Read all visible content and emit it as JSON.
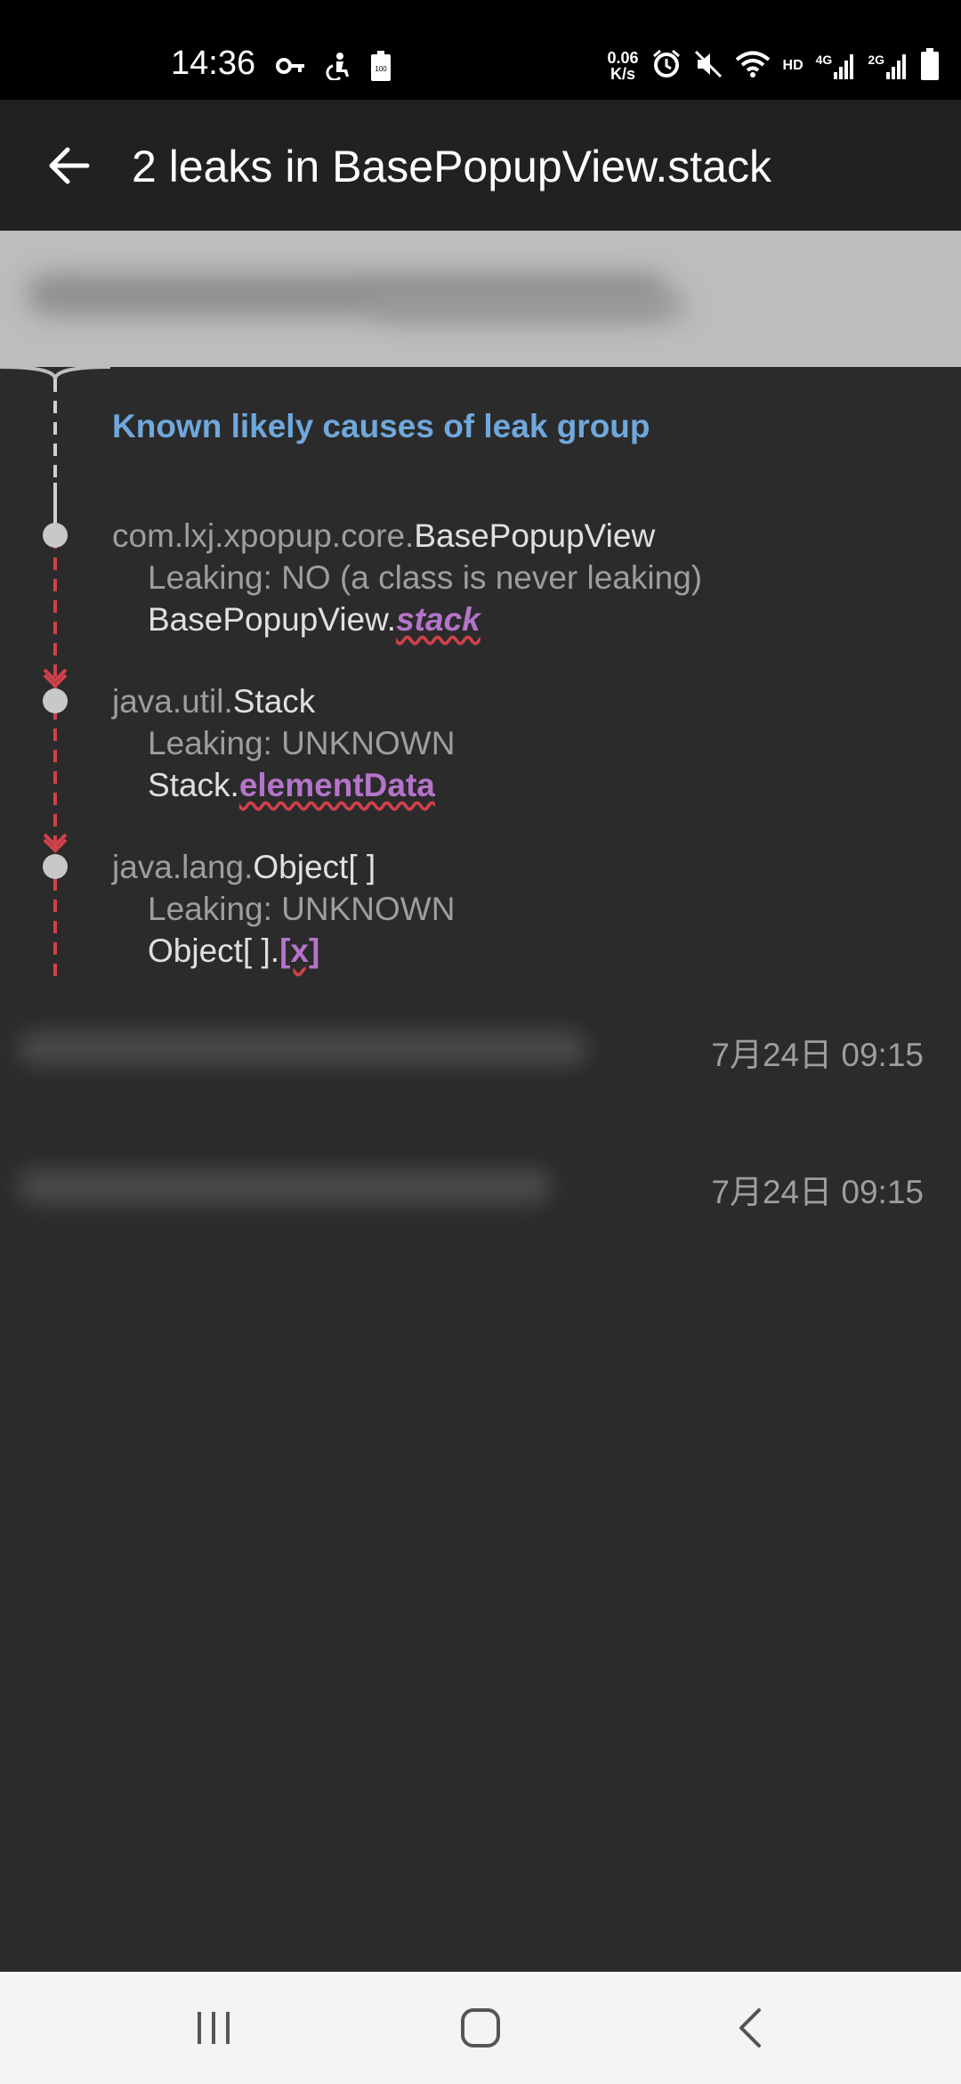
{
  "status_bar": {
    "time": "14:36",
    "net_speed_value": "0.06",
    "net_speed_unit": "K/s",
    "hd_label": "HD",
    "signal_1_label": "4G",
    "signal_2_label": "2G",
    "battery_small_label": "100",
    "icons": [
      "key-icon",
      "accessibility-icon",
      "battery-saver-icon",
      "alarm-icon",
      "mute-icon",
      "wifi-icon",
      "signal-icon",
      "battery-icon"
    ]
  },
  "toolbar": {
    "title": "2 leaks in BasePopupView.stack",
    "back_icon": "back-arrow-icon"
  },
  "leaktrace": {
    "known_causes_title": "Known likely causes of leak group",
    "nodes": [
      {
        "package": "com.lxj.xpopup.core.",
        "class_name": "BasePopupView",
        "leaking": "Leaking: NO (a class is never leaking)",
        "ref_owner": "BasePopupView.",
        "ref_field": "stack"
      },
      {
        "package": "java.util.",
        "class_name": "Stack",
        "leaking": "Leaking: UNKNOWN",
        "ref_owner": "Stack.",
        "ref_field": "elementData"
      },
      {
        "package": "java.lang.",
        "class_name": "Object[ ]",
        "leaking": "Leaking: UNKNOWN",
        "ref_owner": "Object[ ].",
        "ref_field": "[x]"
      }
    ]
  },
  "leaks_list": [
    {
      "time": "7月24日 09:15"
    },
    {
      "time": "7月24日 09:15"
    }
  ],
  "nav_bar": {
    "icons": [
      "recents-icon",
      "home-icon",
      "back-icon"
    ]
  },
  "colors": {
    "background": "#2b2b2b",
    "toolbar": "#212121",
    "known_causes": "#6fa8dc",
    "leak_line": "#d0414b",
    "reference_field": "#b574c9"
  }
}
